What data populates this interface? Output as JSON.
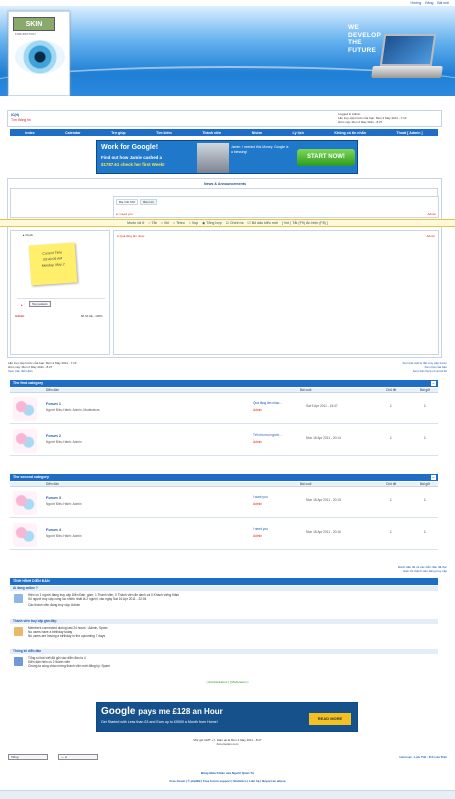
{
  "top_links": [
    "Hướng",
    "Đăng",
    "Bài mới"
  ],
  "header": {
    "logo_word": "SKIN",
    "logo_sub": "FORUMOTION",
    "slogan": [
      "WE",
      "DEVELOP",
      "THE",
      "FUTURE"
    ]
  },
  "userbox": {
    "left_title": "IC(H)",
    "left_sub": "Tìm thông tin",
    "right_lines": [
      "Logged in Admin",
      "Lần truy cập trước của bạn: Mon 2 May 2011 - 7:13",
      "Hôm nay: Mon 2 May 2011 - 8:27"
    ]
  },
  "nav": [
    "Index",
    "Calendar",
    "Trợ giúp",
    "Tìm kiếm",
    "Thành viên",
    "Nhóm",
    "Lý lịch",
    "Không có tin nhắn",
    "Thoát [ Admin ]"
  ],
  "ad1": {
    "line1": "Work for",
    "brand": "Google!",
    "line2": "Find out how Jamie cashed a",
    "line3": "$1787.61 check her first Week!",
    "line4": "Jamie: I needed this Money. Google is a blessing!",
    "cta": "START NOW!"
  },
  "news": {
    "title": "News & Announcements",
    "tabs": [
      "Bài Viết Mới",
      "Bài mới"
    ],
    "item": "I need you",
    "item_user": "Admin"
  },
  "toolbar": {
    "items": [
      "Muốn xã ở",
      "Tắt",
      "Vbl",
      "Teleo",
      "Vop",
      "Tổng hợp",
      "Chính ta",
      "Bỏ dấu kiểu mới",
      "Vnt",
      "Tắt",
      "F9",
      "Ẩn hiện",
      "F8"
    ]
  },
  "sidebar": {
    "clock_label": "Clock",
    "sticky": [
      "Current Time",
      "09:40:05 AM",
      "Monday, May 2"
    ],
    "top_posters": "Top posters",
    "poster_name": "Admin",
    "poster_stat": "86 Số bài - 100%"
  },
  "right_box": {
    "title": "Quà tặng âm nhạc",
    "user": "Admin"
  },
  "footer_info": {
    "left": [
      "Lần truy cập trước của bạn: Mon 2 May 2011 - 7:13",
      "Hôm nay: Mon 2 May 2011 - 8:27",
      "Xem trên diễn đàn"
    ],
    "right": [
      "Xem bài viết từ lần truy cập trước",
      "Xem bài của bạn",
      "Xem bài chưa có ai trả lời"
    ]
  },
  "categories": [
    {
      "title": "The first category",
      "cols": [
        "Diễn đàn",
        "Bài cuối",
        "Chủ đề",
        "Bài gửi"
      ],
      "forums": [
        {
          "name": "Forum 1",
          "mods": "Người Điều Hành: Admin, Moderators",
          "last_title": "Quà tặng âm nhạc...",
          "last_user": "Admin",
          "last_date": "Sat 9 Apr 2011 - 15:47",
          "topics": "1",
          "posts": "1"
        },
        {
          "name": "Forum 2",
          "mods": "Người Điều Hành: Admin",
          "last_title": "Tết cho mọi người...",
          "last_user": "Admin",
          "last_date": "Mon 18 Apr 2011 - 20:14",
          "topics": "1",
          "posts": "1"
        }
      ]
    },
    {
      "title": "The second category",
      "cols": [
        "Diễn đàn",
        "Bài cuối",
        "Chủ đề",
        "Bài gửi"
      ],
      "forums": [
        {
          "name": "Forum 3",
          "mods": "Người Điều Hành: Admin",
          "last_title": "I want you",
          "last_user": "Admin",
          "last_date": "Mon 18 Apr 2011 - 20:15",
          "topics": "1",
          "posts": "1"
        },
        {
          "name": "Forum 4",
          "mods": "Người Điều Hành: Admin",
          "last_title": "I need you",
          "last_user": "Admin",
          "last_date": "Mon 18 Apr 2011 - 20:16",
          "topics": "1",
          "posts": "1"
        }
      ]
    }
  ],
  "mark_links": [
    "Đánh dấu tất cả các diễn đàn đã đọc",
    "Hiển thị thành viên đang truy cập"
  ],
  "stats": {
    "title": "TÌNH HÌNH DIỄN ĐÀN",
    "online_h": "Ai đang online ?",
    "online_lines": [
      "Hiện có 1 người đang truy cập Diễn Đàn, gồm: 1 Thành viên, 0 Thành viên ẩn danh và 0 Khách viếng thăm",
      "Số người truy cập cùng lúc nhiều nhất là 2 người, vào ngày Sat 16 Apr 2011 - 22:04",
      "Các thành viên đang truy cập: Admin"
    ],
    "birthday_h": "Thành viên truy cập gần đây:",
    "birthday_lines": [
      "Members connected during last 24 hours : Admin, Spam",
      "No users have a birthday today",
      "No users are having a birthday in the upcoming 7 days"
    ],
    "stats_h": "Thống kê diễn đàn",
    "stats_lines": [
      "Tổng số bài viết đã gửi vào diễn đàn là 4",
      "Diễn đàn hiện có 2 thành viên",
      "Chúng ta cùng chào mừng thành viên mới đăng ký: Spam"
    ],
    "legend": "[ Administrators ] [ Moderators ]"
  },
  "ad2": {
    "brand": "Google",
    "headline": "pays me £128 an Hour",
    "sub": "Get Started with Less than £3 and Earn up to £9000 a Month from Home!",
    "cta": "READ MORE"
  },
  "bottom": {
    "time_line": "Múi giờ GMT +7. Hiện tại là Mon 2 May 2011 - 8:27",
    "copy_line": "Forumotion.com",
    "select1": "Tiếng",
    "select2": "--- vi",
    "right_link": "Liên Lạc - Lưu Trữ - Trở Lên Trên",
    "credits": "Đăng Điều Khiển của Người Quản Trị",
    "footer_links": "Free forum | © phpBB | Free forum support | Statistics | Liên hệ | Report an abuse"
  }
}
